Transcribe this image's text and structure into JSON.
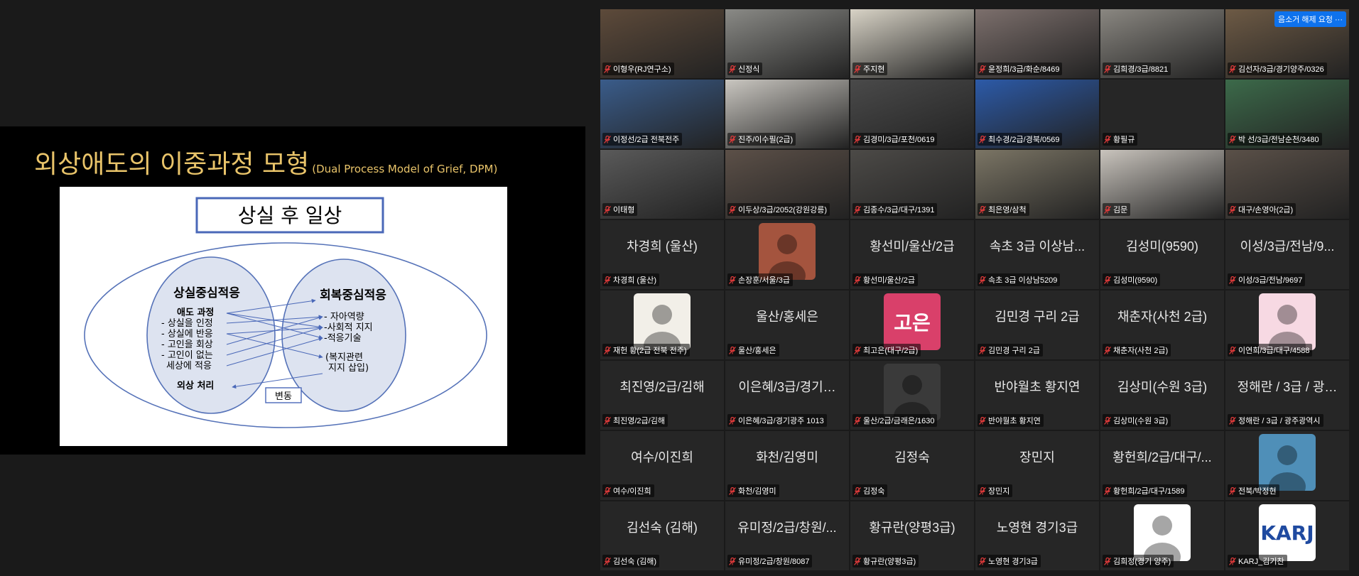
{
  "slide": {
    "title_main": "외상애도의 이중과정 모형",
    "title_sub": "(Dual Process Model of Grief, DPM)",
    "header_box": "상실 후 일상",
    "loss_title": "상실중심적응",
    "loss_items": [
      "애도 과정",
      "- 상실을 인정",
      "- 상실에 반응",
      "- 고인을 회상",
      "- 고인이 없는",
      "  세상에 적응",
      "외상 처리"
    ],
    "restore_title": "회복중심적응",
    "restore_items": [
      "- 자아역량",
      "-사회적 지지",
      "-적응기술",
      "(복지관련",
      " 지지 삽입)"
    ],
    "change_box": "변동"
  },
  "top_button": "음소거 해제 요청",
  "tiles": [
    {
      "type": "cam",
      "tag": "이형우(RJ연구소)",
      "bg": "#5d4a3a"
    },
    {
      "type": "cam",
      "tag": "신정식",
      "bg": "#8a8a86",
      "active": true
    },
    {
      "type": "cam",
      "tag": "주지현",
      "bg": "#d8d3c6"
    },
    {
      "type": "cam",
      "tag": "윤정희/3급/화순/8469",
      "bg": "#7c6f6c"
    },
    {
      "type": "cam",
      "tag": "김희경/3급/8821",
      "bg": "#8a8781"
    },
    {
      "type": "cam",
      "tag": "김선자/3급/경기양주/0326",
      "bg": "#6d5a45"
    },
    {
      "type": "cam",
      "tag": "이정선/2급 전북전주",
      "bg": "#3a5c8a"
    },
    {
      "type": "cam",
      "tag": "진주/이수필(2급)",
      "bg": "#c9c6c0"
    },
    {
      "type": "cam",
      "tag": "김경미/3급/포천/0619",
      "bg": "#4a4a4a"
    },
    {
      "type": "cam",
      "tag": "최수경/2급/경북/0569",
      "bg": "#2c5aa8"
    },
    {
      "type": "name",
      "tag": "황필규",
      "name": ""
    },
    {
      "type": "cam",
      "tag": "박 선/3급/전남순천/3480",
      "bg": "#3c6a4a"
    },
    {
      "type": "cam",
      "tag": "이태형",
      "bg": "#5a5a5a"
    },
    {
      "type": "cam",
      "tag": "이두상/3급/2052(강원강릉)",
      "bg": "#5c5048"
    },
    {
      "type": "cam",
      "tag": "김종수/3급/대구/1391",
      "bg": "#4c4a47"
    },
    {
      "type": "cam",
      "tag": "최은영/삼척",
      "bg": "#7b7565"
    },
    {
      "type": "cam",
      "tag": "김문",
      "bg": "#c9c4bd"
    },
    {
      "type": "cam",
      "tag": "대구/손영아(2급)",
      "bg": "#5a5048"
    },
    {
      "type": "name",
      "tag": "차경희 (울산)",
      "name": "차경희 (울산)"
    },
    {
      "type": "avatar",
      "tag": "손장훈/서울/3급",
      "avatar_bg": "#a4543e"
    },
    {
      "type": "name",
      "tag": "황선미/울산/2급",
      "name": "황선미/울산/2급"
    },
    {
      "type": "name",
      "tag": "속초 3급 이상남5209",
      "name": "속초 3급 이상남..."
    },
    {
      "type": "name",
      "tag": "김성미(9590)",
      "name": "김성미(9590)"
    },
    {
      "type": "name",
      "tag": "이성/3급/전남/9697",
      "name": "이성/3급/전남/9..."
    },
    {
      "type": "avatar",
      "tag": "재헌 황(2급 전북 전주)",
      "avatar_bg": "#f2efe8"
    },
    {
      "type": "name",
      "tag": "울산/홍세은",
      "name": "울산/홍세은"
    },
    {
      "type": "avatar",
      "tag": "최고은(대구/2급)",
      "avatar_bg": "#d9406a",
      "avatar_text": "고은"
    },
    {
      "type": "name",
      "tag": "김민경 구리 2급",
      "name": "김민경 구리 2급"
    },
    {
      "type": "name",
      "tag": "채춘자(사천 2급)",
      "name": "채춘자(사천 2급)"
    },
    {
      "type": "avatar",
      "tag": "이연희/3급/대구/4588",
      "avatar_bg": "#f7d9e3"
    },
    {
      "type": "name",
      "tag": "최진영/2급/김해",
      "name": "최진영/2급/김해"
    },
    {
      "type": "name",
      "tag": "이은혜/3급/경기광주 1013",
      "name": "이은혜/3급/경기…"
    },
    {
      "type": "avatar",
      "tag": "울산/2급/금래은/1630",
      "avatar_bg": "#3a3a3a"
    },
    {
      "type": "name",
      "tag": "반야월초 황지연",
      "name": "반야월초 황지연"
    },
    {
      "type": "name",
      "tag": "김상미(수원 3급)",
      "name": "김상미(수원 3급)"
    },
    {
      "type": "name",
      "tag": "정해란 / 3급 / 광주광역시",
      "name": "정해란 / 3급 / 광…"
    },
    {
      "type": "name",
      "tag": "여수/이진희",
      "name": "여수/이진희"
    },
    {
      "type": "name",
      "tag": "화천/김영미",
      "name": "화천/김영미"
    },
    {
      "type": "name",
      "tag": "김정숙",
      "name": "김정숙"
    },
    {
      "type": "name",
      "tag": "장민지",
      "name": "장민지"
    },
    {
      "type": "name",
      "tag": "황헌희/2급/대구/1589",
      "name": "황헌희/2급/대구/..."
    },
    {
      "type": "avatar",
      "tag": "전북/박정현",
      "avatar_bg": "#4f8fb8"
    },
    {
      "type": "name",
      "tag": "김선숙 (김해)",
      "name": "김선숙 (김해)"
    },
    {
      "type": "name",
      "tag": "유미정/2급/창원/8087",
      "name": "유미정/2급/창원/..."
    },
    {
      "type": "name",
      "tag": "황규란(양평3급)",
      "name": "황규란(양평3급)"
    },
    {
      "type": "name",
      "tag": "노영현 경기3급",
      "name": "노영현 경기3급"
    },
    {
      "type": "avatar",
      "tag": "김희정(경기 양주)",
      "avatar_bg": "#ffffff"
    },
    {
      "type": "avatar",
      "tag": "KARJ_김기찬",
      "avatar_bg": "#ffffff",
      "avatar_text": "KARJ"
    }
  ]
}
